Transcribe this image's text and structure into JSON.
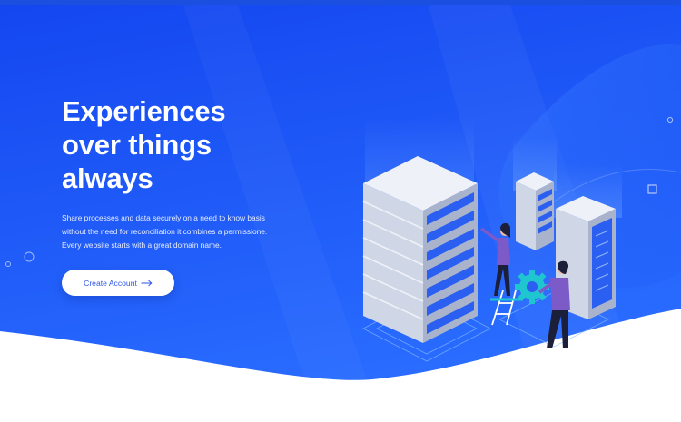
{
  "colors": {
    "background_top": "#1447f0",
    "background_bottom": "#2a6cff",
    "accent": "#2b56e8",
    "button_bg": "#ffffff",
    "headline": "#ffffff"
  },
  "hero": {
    "headline_lines": [
      "Experiences",
      "over things",
      "always"
    ],
    "description_lines": [
      "Share processes and data securely on a need to know basis",
      "without the need for reconciliation it combines a permissione.",
      "Every website starts with a great domain name."
    ],
    "cta_label": "Create Account",
    "cta_icon": "arrow-right-icon"
  },
  "illustration": {
    "subject": "server-racks-with-technicians",
    "icons": [
      "server-rack-icon",
      "gear-icon",
      "person-icon",
      "ladder-icon"
    ]
  }
}
